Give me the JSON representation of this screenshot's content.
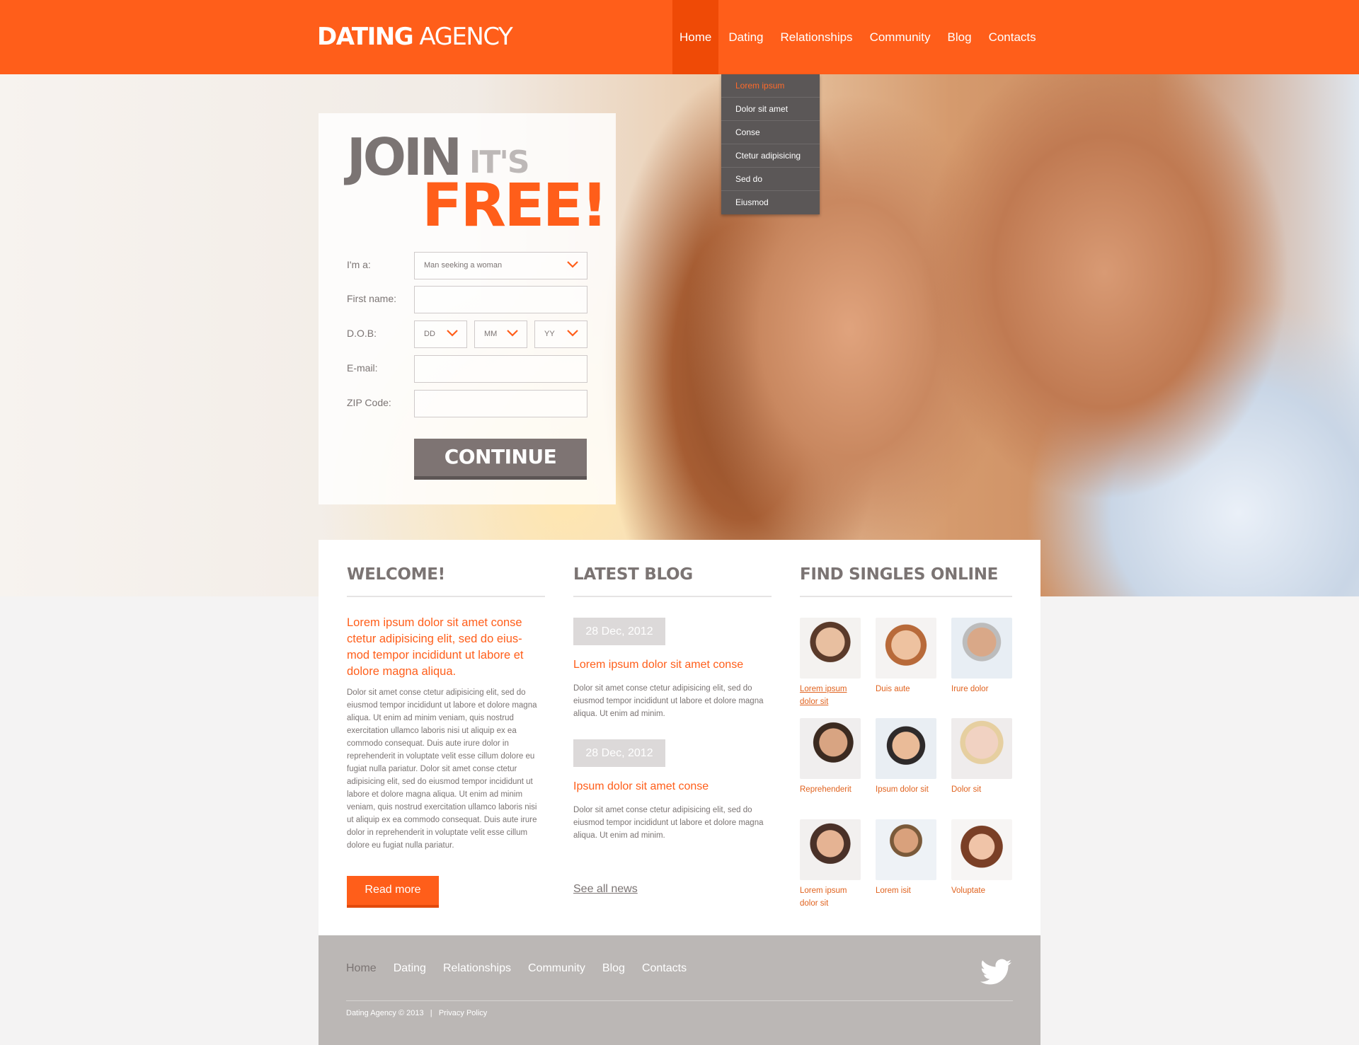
{
  "header": {
    "logo_bold": "DATING",
    "logo_light": "AGENCY",
    "nav": [
      {
        "label": "Home",
        "active": true
      },
      {
        "label": "Dating"
      },
      {
        "label": "Relationships"
      },
      {
        "label": "Community"
      },
      {
        "label": "Blog"
      },
      {
        "label": "Contacts"
      }
    ],
    "dropdown": [
      "Lorem ipsum",
      "Dolor sit amet",
      "Conse",
      "Ctetur adipisicing",
      "Sed do",
      "Eiusmod"
    ]
  },
  "signup": {
    "join": "JOIN",
    "its": "IT'S",
    "free": "FREE!",
    "labels": {
      "im_a": "I'm a:",
      "first_name": "First name:",
      "dob": "D.O.B:",
      "email": "E-mail:",
      "zip": "ZIP Code:"
    },
    "im_a_value": "Man seeking a woman",
    "dob": {
      "dd": "DD",
      "mm": "MM",
      "yy": "YY"
    },
    "first_name_value": "",
    "email_value": "",
    "zip_value": "",
    "continue_label": "CONTINUE"
  },
  "welcome": {
    "title": "WELCOME!",
    "lead": "Lorem ipsum dolor sit amet conse ctetur adipisicing elit, sed do eius-mod tempor incididunt ut labore et dolore magna aliqua.",
    "body": "Dolor sit amet conse ctetur adipisicing elit, sed do eiusmod tempor incididunt ut labore et dolore magna aliqua. Ut enim ad minim veniam, quis nostrud exercitation ullamco laboris nisi ut aliquip ex ea commodo consequat. Duis aute irure dolor in reprehenderit in voluptate velit esse cillum dolore eu fugiat nulla pariatur.  Dolor sit amet conse ctetur adipisicing elit, sed do eiusmod tempor incididunt ut labore et dolore magna aliqua. Ut enim ad minim veniam, quis nostrud exercitation ullamco laboris nisi ut aliquip ex ea commodo consequat. Duis aute irure dolor in reprehenderit in voluptate velit esse cillum dolore eu fugiat nulla pariatur.",
    "read_more": "Read more"
  },
  "blog": {
    "title": "LATEST BLOG",
    "posts": [
      {
        "date": "28 Dec, 2012",
        "title": "Lorem ipsum dolor sit amet conse",
        "text": "Dolor sit amet conse ctetur adipisicing elit, sed do eiusmod tempor incididunt ut labore et dolore magna aliqua. Ut enim ad minim."
      },
      {
        "date": "28 Dec, 2012",
        "title": "Ipsum dolor sit amet conse",
        "text": "Dolor sit amet conse ctetur adipisicing elit, sed do eiusmod tempor incididunt ut labore et dolore magna aliqua. Ut enim ad minim."
      }
    ],
    "see_all": "See all news"
  },
  "singles": {
    "title": "FIND SINGLES ONLINE",
    "people": [
      {
        "name": "Lorem ipsum dolor sit"
      },
      {
        "name": "Duis aute"
      },
      {
        "name": "Irure dolor"
      },
      {
        "name": "Reprehenderit"
      },
      {
        "name": "Ipsum dolor sit"
      },
      {
        "name": "Dolor sit"
      },
      {
        "name": "Lorem ipsum dolor sit"
      },
      {
        "name": "Lorem isit"
      },
      {
        "name": "Voluptate"
      }
    ]
  },
  "footer": {
    "nav": [
      "Home",
      "Dating",
      "Relationships",
      "Community",
      "Blog",
      "Contacts"
    ],
    "copyright": "Dating Agency © 2013",
    "separator": "|",
    "privacy": "Privacy Policy",
    "social_icon": "twitter-icon"
  },
  "colors": {
    "accent": "#ff5e1a",
    "accent_dark": "#ef4a06",
    "text_gray": "#7b7473",
    "dropdown_bg": "#5b5757",
    "footer_bg": "#bbb7b5"
  }
}
